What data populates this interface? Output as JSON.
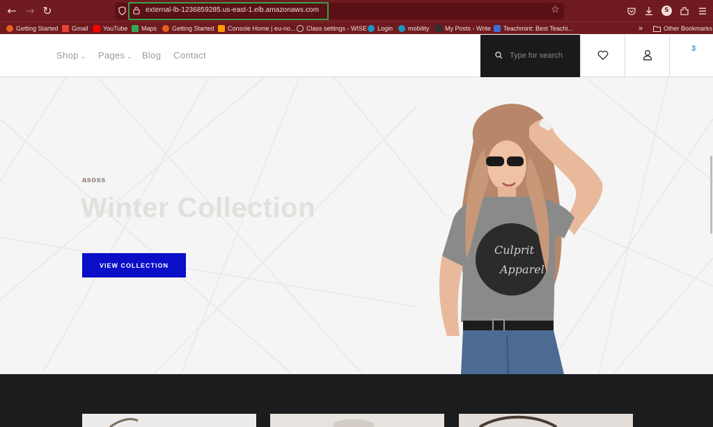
{
  "browser": {
    "url": "external-lb-1236859285.us-east-1.elb.amazonaws.com",
    "profile_initial": "S",
    "bookmarks": [
      {
        "label": "Getting Started",
        "color": "#e8601c"
      },
      {
        "label": "Gmail",
        "color": "#ea4335"
      },
      {
        "label": "YouTube",
        "color": "#ff0000"
      },
      {
        "label": "Maps",
        "color": "#34a853"
      },
      {
        "label": "Getting Started",
        "color": "#e8601c"
      },
      {
        "label": "Console Home | eu-no...",
        "color": "#ff9900"
      },
      {
        "label": "Class settings - WISE",
        "color": "#cccccc"
      },
      {
        "label": "Login",
        "color": "#1798c1"
      },
      {
        "label": "mobility",
        "color": "#1798c1"
      },
      {
        "label": "My Posts - Write",
        "color": "#2f2f2f"
      },
      {
        "label": "Teachmint: Best Teachi...",
        "color": "#3b6fd6"
      }
    ],
    "other_bookmarks": "Other Bookmarks"
  },
  "site": {
    "nav": {
      "shop": "Shop",
      "pages": "Pages",
      "blog": "Blog",
      "contact": "Contact"
    },
    "search_placeholder": "Type for search",
    "cart_count": "3"
  },
  "hero": {
    "eyebrow": "asoss",
    "title": "Winter Collection",
    "button": "VIEW COLLECTION",
    "shirt_text_1": "Culprit",
    "shirt_text_2": "Apparel"
  },
  "colors": {
    "chrome": "#6e1a1e",
    "accent_button": "#0a0ec7",
    "dark_section": "#1b1c1e",
    "url_highlight": "#3aa14b"
  }
}
